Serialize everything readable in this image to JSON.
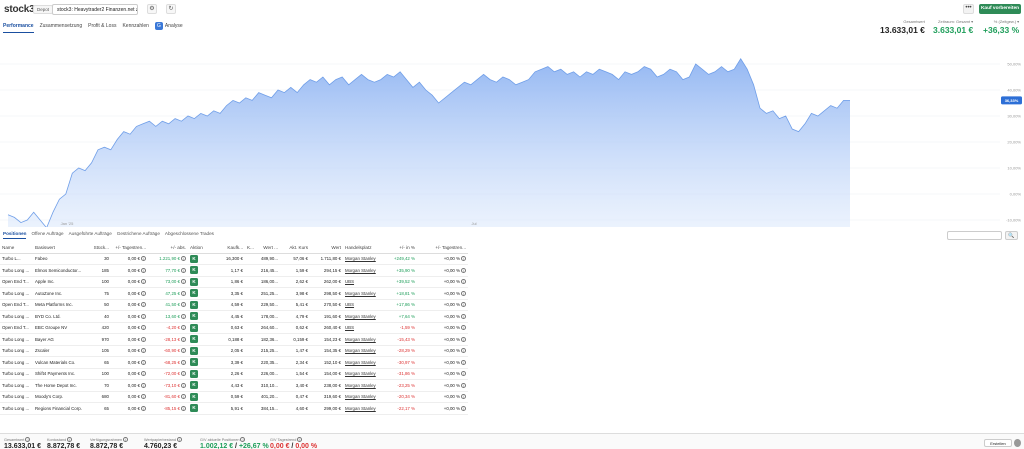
{
  "app": {
    "logo": "stock3",
    "logo_sup": "3"
  },
  "depot": {
    "label": "Depot",
    "name": "stock3: Heavytrader2 Finanzen.net zero"
  },
  "actions": {
    "more": "•••",
    "buy": "Kauf vorbereiten"
  },
  "tabs": [
    {
      "label": "Performance"
    },
    {
      "label": "Zusammensetzung"
    },
    {
      "label": "Profit & Loss"
    },
    {
      "label": "Kennzahlen"
    },
    {
      "label": "Analyse"
    }
  ],
  "summary": {
    "total_label": "Gesamtwert",
    "total_value": "13.633,01 €",
    "period_label": "Zeitraum: Gesamt ▾",
    "period_value": "3.633,01 €",
    "pct_label": "% (Zeitgew.) ▾",
    "pct_value": "+36,33 %"
  },
  "chart_data": {
    "type": "area",
    "y_ticks": [
      "50,00%",
      "40,00%",
      "30,00%",
      "20,00%",
      "10,00%",
      "0,00%",
      "-10,00%"
    ],
    "x_ticks": [
      "Jan '25",
      "Jul"
    ],
    "current_label": "36,33%",
    "ylim": [
      -13,
      56
    ],
    "values": [
      -8,
      -9,
      -11,
      -10,
      -7,
      -10,
      -13,
      -7,
      -2,
      0,
      8,
      10,
      9,
      12,
      17,
      18,
      17,
      21,
      24,
      23,
      26,
      27,
      28,
      26,
      28,
      27,
      29,
      28,
      30,
      29,
      31,
      30,
      32,
      31,
      34,
      36,
      35,
      37,
      36,
      39,
      38,
      37,
      40,
      39,
      41,
      39,
      42,
      44,
      43,
      45,
      42,
      44,
      45,
      42,
      44,
      46,
      44,
      43,
      44,
      46,
      45,
      47,
      44,
      41,
      43,
      40,
      38,
      35,
      37,
      39,
      41,
      43,
      42,
      44,
      46,
      44,
      43,
      45,
      44,
      42,
      43,
      44,
      47,
      48,
      49,
      47,
      48,
      46,
      47,
      45,
      47,
      46,
      48,
      47,
      46,
      44,
      47,
      46,
      47,
      49,
      48,
      45,
      46,
      48,
      47,
      44,
      45,
      50,
      48,
      46,
      47,
      49,
      47,
      48,
      52,
      48,
      42,
      33,
      31,
      32,
      29,
      30,
      25,
      24,
      27,
      31,
      30,
      32,
      34,
      33,
      36,
      36
    ]
  },
  "positions": {
    "tabs": [
      {
        "label": "Positionen"
      },
      {
        "label": "Offene Aufträge"
      },
      {
        "label": "Ausgeführte Aufträge"
      },
      {
        "label": "Gestrichene Aufträge"
      },
      {
        "label": "Abgeschlossene Trades"
      }
    ],
    "search_icon": "🔍",
    "columns": [
      "Name",
      "Basiswert",
      "Stück...",
      "+/- Tagestren...",
      "+/- abs.",
      "Aktion",
      "Kaufk...",
      "K...",
      "Wert ...",
      "Akt. Kurs",
      "Wert",
      "Handelsplatz",
      "+/- in %",
      "+/- Tagestren..."
    ],
    "rows": [
      {
        "name": "Turbo L...",
        "under": "Fabeo",
        "qty": "30",
        "day": "0,00 €",
        "abs": "1.221,90 €",
        "abs_c": "green",
        "buy": "16,300 €",
        "k": "",
        "wert1": "489,90...",
        "kurs": "57,06 €",
        "wert": "1.711,80 €",
        "venue": "Morgan Stanley",
        "pct": "+249,42 %",
        "pct_c": "green",
        "dayp": "+0,00 %"
      },
      {
        "name": "Turbo Long ...",
        "under": "Elmos Semiconductor...",
        "qty": "185",
        "day": "0,00 €",
        "abs": "77,70 €",
        "abs_c": "green",
        "buy": "1,17 €",
        "k": "",
        "wert1": "216,45...",
        "kurs": "1,59 €",
        "wert": "294,15 €",
        "venue": "Morgan Stanley",
        "pct": "+35,90 %",
        "pct_c": "green",
        "dayp": "+0,00 %"
      },
      {
        "name": "Open End T...",
        "under": "Apple Inc.",
        "qty": "100",
        "day": "0,00 €",
        "abs": "73,00 €",
        "abs_c": "green",
        "buy": "1,86 €",
        "k": "",
        "wert1": "186,00...",
        "kurs": "2,62 €",
        "wert": "262,00 €",
        "venue": "UBS",
        "pct": "+39,52 %",
        "pct_c": "green",
        "dayp": "+0,00 %"
      },
      {
        "name": "Turbo Long ...",
        "under": "AutoZone Inc.",
        "qty": "75",
        "day": "0,00 €",
        "abs": "47,25 €",
        "abs_c": "green",
        "buy": "3,35 €",
        "k": "",
        "wert1": "251,25...",
        "kurs": "3,98 €",
        "wert": "298,50 €",
        "venue": "Morgan Stanley",
        "pct": "+18,81 %",
        "pct_c": "green",
        "dayp": "+0,00 %"
      },
      {
        "name": "Open End T...",
        "under": "Meta Platforms Inc.",
        "qty": "50",
        "day": "0,00 €",
        "abs": "41,50 €",
        "abs_c": "green",
        "buy": "4,59 €",
        "k": "",
        "wert1": "229,50...",
        "kurs": "5,41 €",
        "wert": "270,50 €",
        "venue": "UBS",
        "pct": "+17,86 %",
        "pct_c": "green",
        "dayp": "+0,00 %"
      },
      {
        "name": "Turbo Long ...",
        "under": "BYD Co. Ltd.",
        "qty": "40",
        "day": "0,00 €",
        "abs": "13,60 €",
        "abs_c": "green",
        "buy": "4,45 €",
        "k": "",
        "wert1": "178,00...",
        "kurs": "4,79 €",
        "wert": "191,60 €",
        "venue": "Morgan Stanley",
        "pct": "+7,64 %",
        "pct_c": "green",
        "dayp": "+0,00 %"
      },
      {
        "name": "Open End T...",
        "under": "EBC Groupe NV",
        "qty": "420",
        "day": "0,00 €",
        "abs": "-4,20 €",
        "abs_c": "red",
        "buy": "0,63 €",
        "k": "",
        "wert1": "264,60...",
        "kurs": "0,62 €",
        "wert": "260,40 €",
        "venue": "UBS",
        "pct": "-1,59 %",
        "pct_c": "red",
        "dayp": "+0,00 %"
      },
      {
        "name": "Turbo Long ...",
        "under": "Bayer AG",
        "qty": "970",
        "day": "0,00 €",
        "abs": "-28,13 €",
        "abs_c": "red",
        "buy": "0,188 €",
        "k": "",
        "wert1": "182,36...",
        "kurs": "0,159 €",
        "wert": "154,23 €",
        "venue": "Morgan Stanley",
        "pct": "-15,43 %",
        "pct_c": "red",
        "dayp": "+0,00 %"
      },
      {
        "name": "Turbo Long ...",
        "under": "Zscaler",
        "qty": "105",
        "day": "0,00 €",
        "abs": "-60,90 €",
        "abs_c": "red",
        "buy": "2,05 €",
        "k": "",
        "wert1": "215,25...",
        "kurs": "1,47 €",
        "wert": "154,35 €",
        "venue": "Morgan Stanley",
        "pct": "-28,29 %",
        "pct_c": "red",
        "dayp": "+0,00 %"
      },
      {
        "name": "Turbo Long ...",
        "under": "Vulcan Materials Co.",
        "qty": "65",
        "day": "0,00 €",
        "abs": "-68,25 €",
        "abs_c": "red",
        "buy": "3,39 €",
        "k": "",
        "wert1": "220,35...",
        "kurs": "2,34 €",
        "wert": "152,10 €",
        "venue": "Morgan Stanley",
        "pct": "-30,97 %",
        "pct_c": "red",
        "dayp": "+0,00 %"
      },
      {
        "name": "Turbo Long ...",
        "under": "Shift4 Payments Inc.",
        "qty": "100",
        "day": "0,00 €",
        "abs": "-72,00 €",
        "abs_c": "red",
        "buy": "2,26 €",
        "k": "",
        "wert1": "226,00...",
        "kurs": "1,54 €",
        "wert": "154,00 €",
        "venue": "Morgan Stanley",
        "pct": "-31,86 %",
        "pct_c": "red",
        "dayp": "+0,00 %"
      },
      {
        "name": "Turbo Long ...",
        "under": "The Home Depot Inc.",
        "qty": "70",
        "day": "0,00 €",
        "abs": "-73,10 €",
        "abs_c": "red",
        "buy": "4,43 €",
        "k": "",
        "wert1": "310,10...",
        "kurs": "3,40 €",
        "wert": "238,00 €",
        "venue": "Morgan Stanley",
        "pct": "-23,25 %",
        "pct_c": "red",
        "dayp": "+0,00 %"
      },
      {
        "name": "Turbo Long ...",
        "under": "Moody's Corp.",
        "qty": "680",
        "day": "0,00 €",
        "abs": "-81,60 €",
        "abs_c": "red",
        "buy": "0,59 €",
        "k": "",
        "wert1": "401,20...",
        "kurs": "0,47 €",
        "wert": "319,60 €",
        "venue": "Morgan Stanley",
        "pct": "-20,34 %",
        "pct_c": "red",
        "dayp": "+0,00 %"
      },
      {
        "name": "Turbo Long ...",
        "under": "Regions Financial Corp.",
        "qty": "65",
        "day": "0,00 €",
        "abs": "-85,15 €",
        "abs_c": "red",
        "buy": "5,91 €",
        "k": "",
        "wert1": "384,15...",
        "kurs": "4,60 €",
        "wert": "299,00 €",
        "venue": "Morgan Stanley",
        "pct": "-22,17 %",
        "pct_c": "red",
        "dayp": "+0,00 %"
      }
    ],
    "action_label": "K",
    "info_glyph": "i"
  },
  "footer": {
    "items": [
      {
        "label": "Gesamtwert",
        "value": "13.633,01 €",
        "value2": ""
      },
      {
        "label": "Kontostand",
        "value": "8.872,78 €",
        "value2": ""
      },
      {
        "label": "Verfügungsrahmen",
        "value": "8.872,78 €",
        "value2": ""
      },
      {
        "label": "Wertpapierbestand",
        "value": "4.760,23 €",
        "value2": ""
      },
      {
        "label": "G/V aktuelle Positionen",
        "value": "1.002,12 €",
        "value2": "+26,67 %"
      },
      {
        "label": "G/V Tagestrend",
        "value": "0,00 €",
        "value2": "0,00 %"
      }
    ],
    "button": "Erstellen"
  },
  "colors": {
    "accent": "#1a4fa0",
    "buy": "#2e8b57",
    "positive": "#1e9e5a",
    "negative": "#d33333",
    "area": "#9ec0f5"
  }
}
